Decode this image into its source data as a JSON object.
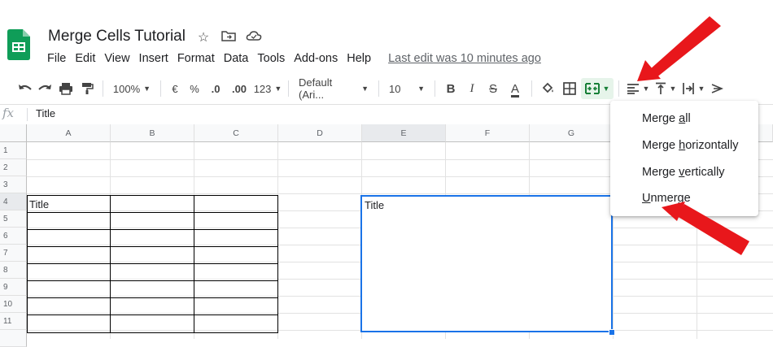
{
  "header": {
    "doc_title": "Merge Cells Tutorial",
    "title_icons": [
      "star-icon",
      "move-to-folder-icon",
      "cloud-status-icon"
    ],
    "last_edit": "Last edit was 10 minutes ago"
  },
  "menubar": [
    "File",
    "Edit",
    "View",
    "Insert",
    "Format",
    "Data",
    "Tools",
    "Add-ons",
    "Help"
  ],
  "toolbar": {
    "zoom": "100%",
    "currency": "€",
    "percent": "%",
    "decrease_decimal": ".0",
    "increase_decimal": ".00",
    "more_formats": "123",
    "font": "Default (Ari...",
    "font_size": "10",
    "bold": "B",
    "italic": "I",
    "strikethrough": "S",
    "text_color": "A",
    "accent_color": "#188038"
  },
  "formula_bar": {
    "fx": "fx",
    "value": "Title"
  },
  "grid": {
    "columns": [
      "A",
      "B",
      "C",
      "D",
      "E",
      "F",
      "G"
    ],
    "rows": [
      "1",
      "2",
      "3",
      "4",
      "5",
      "6",
      "7",
      "8",
      "9",
      "10",
      "11"
    ],
    "selected_column": "E",
    "selected_row": "4",
    "cells": {
      "A4": "Title",
      "E4": "Title"
    },
    "selection_color": "#1a73e8"
  },
  "merge_menu": {
    "items": [
      {
        "label": "Merge all",
        "underline": "a"
      },
      {
        "label": "Merge horizontally",
        "underline": "h"
      },
      {
        "label": "Merge vertically",
        "underline": "v"
      },
      {
        "label": "Unmerge",
        "underline": "U"
      }
    ]
  },
  "annotations": {
    "arrow_color": "#e8171b"
  }
}
